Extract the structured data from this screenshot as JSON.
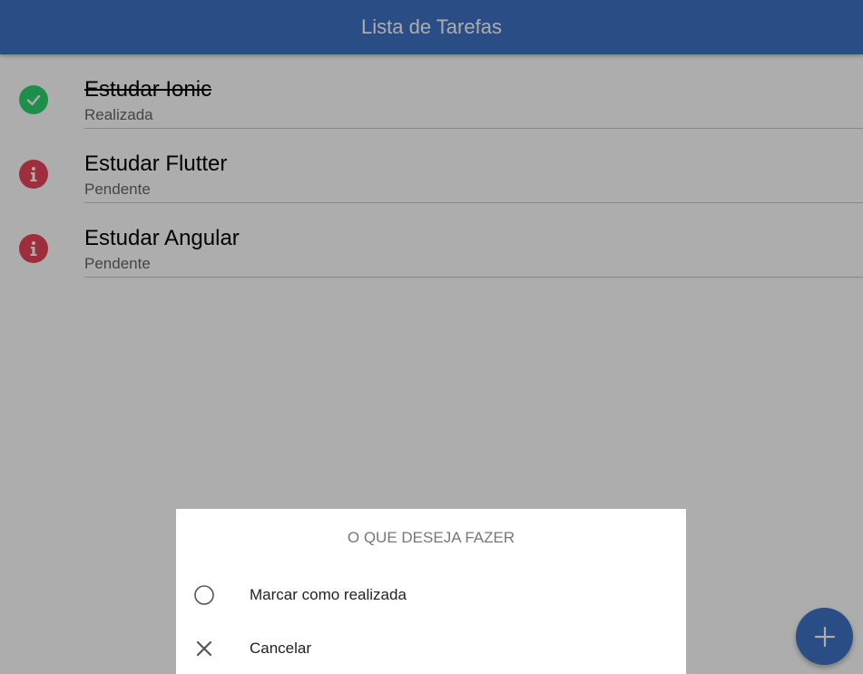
{
  "header": {
    "title": "Lista de Tarefas"
  },
  "tasks": [
    {
      "title": "Estudar Ionic",
      "status": "Realizada",
      "icon": "checkmark-circle-icon",
      "done": true
    },
    {
      "title": "Estudar Flutter",
      "status": "Pendente",
      "icon": "information-circle-icon",
      "done": false
    },
    {
      "title": "Estudar Angular",
      "status": "Pendente",
      "icon": "information-circle-icon",
      "done": false
    }
  ],
  "action_sheet": {
    "header": "O QUE DESEJA FAZER",
    "buttons": [
      {
        "label": "Marcar como realizada",
        "icon": "radio-button-off-icon"
      },
      {
        "label": "Cancelar",
        "icon": "close-icon"
      }
    ]
  },
  "fab": {
    "icon": "add-icon"
  },
  "colors": {
    "primary": "#3f72c4",
    "success": "#2dd36f",
    "danger": "#eb445a",
    "backdrop": "rgba(0,0,0,0.32)"
  }
}
